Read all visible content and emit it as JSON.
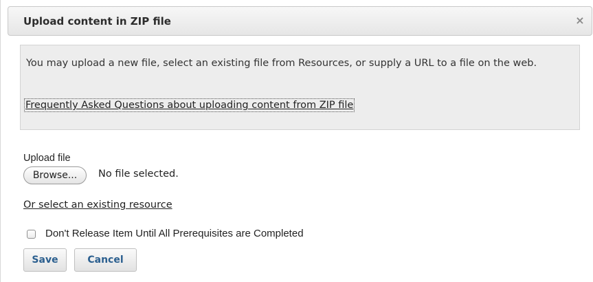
{
  "dialog": {
    "title": "Upload content in ZIP file",
    "close_glyph": "×"
  },
  "info": {
    "text": "You may upload a new file, select an existing file from Resources, or supply a URL to a file on the web.",
    "faq_link": "Frequently Asked Questions about uploading content from ZIP file"
  },
  "upload": {
    "label": "Upload file",
    "browse_label": "Browse...",
    "status": "No file selected."
  },
  "resource_link": "Or select an existing resource",
  "prerequisite": {
    "label": "Don't Release Item Until All Prerequisites are Completed",
    "checked": false
  },
  "actions": {
    "save_label": "Save",
    "cancel_label": "Cancel"
  },
  "colors": {
    "button_text": "#2b5f8f",
    "info_background": "#ededed"
  },
  "icons": {
    "close": "close-icon"
  }
}
